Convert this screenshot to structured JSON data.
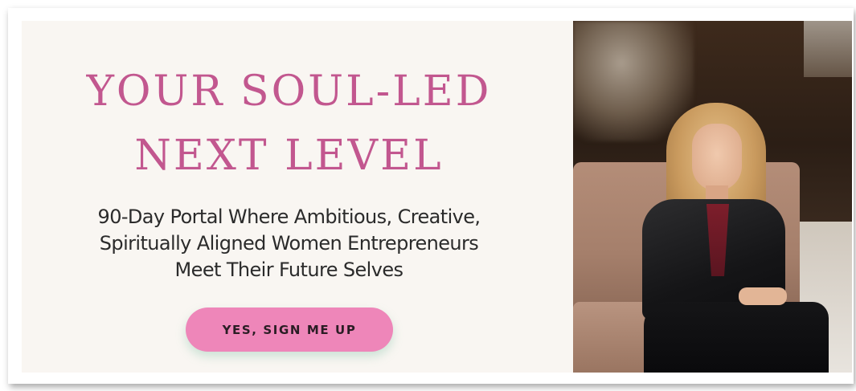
{
  "banner": {
    "headline_line1": "YOUR SOUL-LED",
    "headline_line2": "NEXT LEVEL",
    "subheadline_line1": "90-Day Portal Where Ambitious, Creative,",
    "subheadline_line2": "Spiritually Aligned Women Entrepreneurs",
    "subheadline_line3": "Meet Their Future Selves",
    "cta_label": "YES, SIGN ME UP"
  },
  "colors": {
    "headline": "#c2578f",
    "button": "#ee86b9",
    "background": "#f9f6f2",
    "body_text": "#2b2b2b"
  },
  "photo": {
    "subject": "smiling blonde woman in black leather jacket seated on a tan leather couch"
  }
}
